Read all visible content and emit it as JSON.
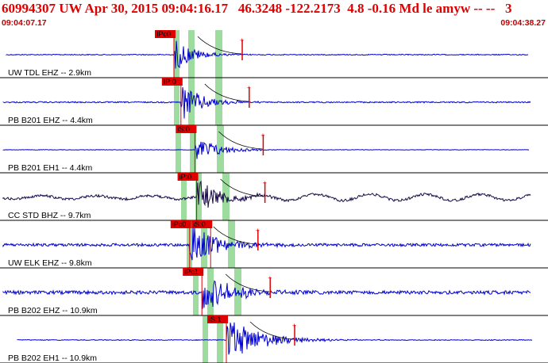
{
  "header": {
    "title": "60994307 UW Apr 30, 2015 09:04:16.17   46.3248 -122.2173  4.8 -0.16 Md le amyw -- --   3",
    "start_time": "09:04:07.17",
    "end_time": "09:04:38.27"
  },
  "colors": {
    "header_text": "#e00000",
    "trace_default": "#0000cc",
    "trace_alt": "#1a0a4a",
    "pick_box": "#e00000",
    "window_band": "#9edb9e",
    "row_divider": "#000000"
  },
  "channels": [
    {
      "label": "UW TDL EHZ -- 2.9km",
      "alt_color": false,
      "picks": [
        {
          "text": "IPc0",
          "t": 0.0
        }
      ]
    },
    {
      "label": "PB B201 EHZ -- 4.4km",
      "alt_color": false,
      "picks": [
        {
          "text": "IP:0",
          "t": 0.4
        }
      ]
    },
    {
      "label": "PB B201 EH1 -- 4.4km",
      "alt_color": false,
      "picks": [
        {
          "text": "iS:0",
          "t": 1.2
        }
      ]
    },
    {
      "label": "CC STD BHZ -- 9.7km",
      "alt_color": true,
      "picks": [
        {
          "text": "iP:0",
          "t": 1.3
        }
      ]
    },
    {
      "label": "UW ELK EHZ -- 9.8km",
      "alt_color": false,
      "picks": [
        {
          "text": "iPc0",
          "t": 0.9
        },
        {
          "text": "iS:0",
          "t": 2.1
        }
      ]
    },
    {
      "label": "PB B202 EHZ -- 10.9km",
      "alt_color": false,
      "picks": [
        {
          "text": "iPc1",
          "t": 1.6
        }
      ]
    },
    {
      "label": "PB B202 EH1 -- 10.9km",
      "alt_color": false,
      "picks": [
        {
          "text": "iS:1",
          "t": 3.0
        }
      ]
    }
  ]
}
